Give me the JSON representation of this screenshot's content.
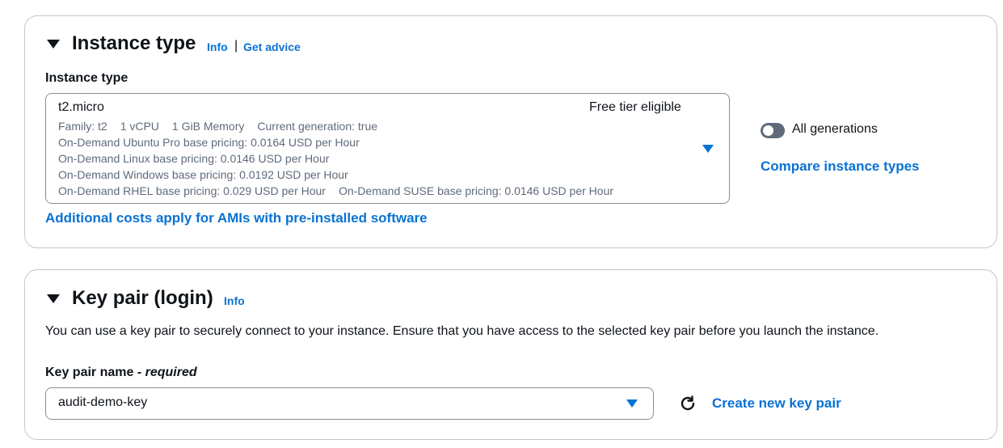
{
  "instance_type_section": {
    "heading": "Instance type",
    "info_link": "Info",
    "separator": "|",
    "advice_link": "Get advice",
    "field_label": "Instance type",
    "selected": {
      "name": "t2.micro",
      "badge": "Free tier eligible",
      "family": "Family: t2",
      "vcpu": "1 vCPU",
      "memory": "1 GiB Memory",
      "generation": "Current generation: true",
      "ubuntu_pro": "On-Demand Ubuntu Pro base pricing: 0.0164 USD per Hour",
      "linux": "On-Demand Linux base pricing: 0.0146 USD per Hour",
      "windows": "On-Demand Windows base pricing: 0.0192 USD per Hour",
      "rhel": "On-Demand RHEL base pricing: 0.029 USD per Hour",
      "suse": "On-Demand SUSE base pricing: 0.0146 USD per Hour"
    },
    "all_generations_label": "All generations",
    "all_generations_on": false,
    "compare_link": "Compare instance types",
    "costs_link": "Additional costs apply for AMIs with pre-installed software"
  },
  "key_pair_section": {
    "heading": "Key pair (login)",
    "info_link": "Info",
    "description": "You can use a key pair to securely connect to your instance. Ensure that you have access to the selected key pair before you launch the instance.",
    "field_label": "Key pair name - ",
    "required_label": "required",
    "selected_value": "audit-demo-key",
    "refresh_icon": "refresh-icon",
    "create_link": "Create new key pair"
  },
  "colors": {
    "link": "#0972d3",
    "text": "#0f141a",
    "secondary_text": "#5f6b7a",
    "border": "#c6c6cd",
    "toggle_off": "#5f6b7a"
  }
}
